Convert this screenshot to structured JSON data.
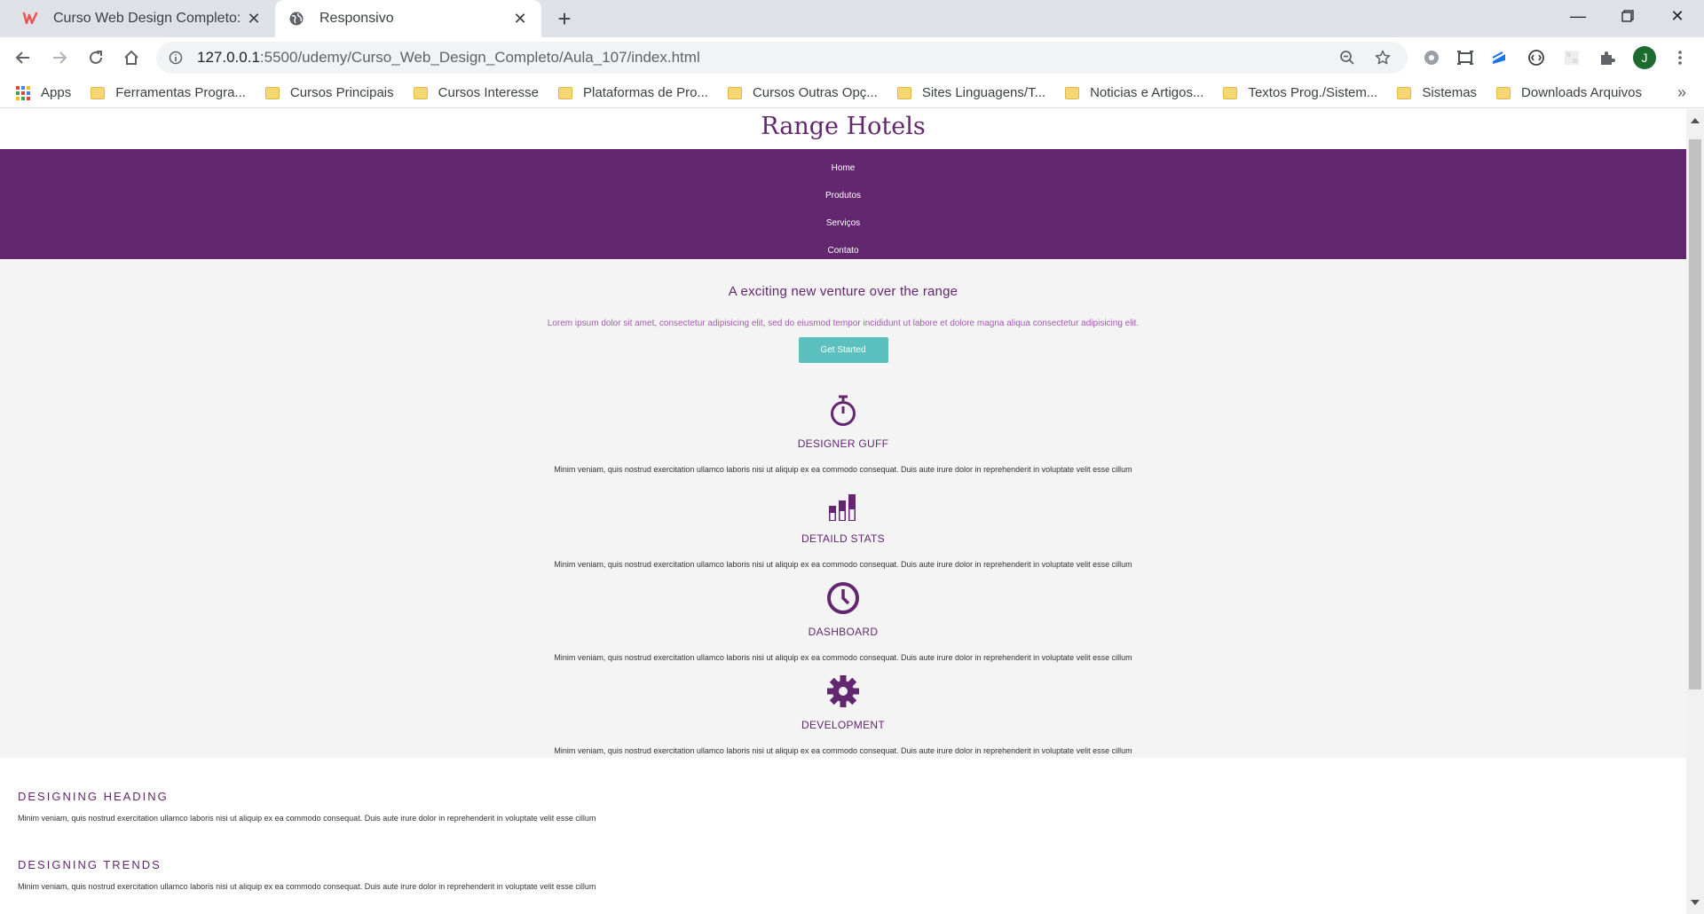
{
  "browser": {
    "tabs": [
      {
        "title": "Curso Web Design Completo: HT",
        "active": false
      },
      {
        "title": "Responsivo",
        "active": true
      }
    ],
    "url": {
      "host": "127.0.0.1",
      "path": ":5500/udemy/Curso_Web_Design_Completo/Aula_107/index.html"
    },
    "profile_initial": "J",
    "bookmarks": [
      "Apps",
      "Ferramentas Progra...",
      "Cursos Principais",
      "Cursos Interesse",
      "Plataformas de Pro...",
      "Cursos Outras Opç...",
      "Sites Linguagens/T...",
      "Noticias e Artigos...",
      "Textos Prog./Sistem...",
      "Sistemas",
      "Downloads Arquivos"
    ]
  },
  "page": {
    "brand": "Range Hotels",
    "nav": [
      "Home",
      "Produtos",
      "Serviços",
      "Contato"
    ],
    "hero": {
      "title": "A exciting new venture over the range",
      "lead": "Lorem ipsum dolor sit amet, consectetur adipisicing elit, sed do eiusmod tempor incididunt ut labore et dolore magna aliqua consectetur adipisicing elit.",
      "button": "Get Started"
    },
    "features": [
      {
        "icon": "stopwatch-icon",
        "title": "DESIGNER GUFF",
        "text": "Minim veniam, quis nostrud exercitation ullamco laboris nisi ut aliquip ex ea commodo consequat. Duis aute irure dolor in reprehenderit in voluptate velit esse cillum"
      },
      {
        "icon": "bar-chart-icon",
        "title": "DETAILD STATS",
        "text": "Minim veniam, quis nostrud exercitation ullamco laboris nisi ut aliquip ex ea commodo consequat. Duis aute irure dolor in reprehenderit in voluptate velit esse cillum"
      },
      {
        "icon": "clock-icon",
        "title": "DASHBOARD",
        "text": "Minim veniam, quis nostrud exercitation ullamco laboris nisi ut aliquip ex ea commodo consequat. Duis aute irure dolor in reprehenderit in voluptate velit esse cillum"
      },
      {
        "icon": "gear-icon",
        "title": "DEVELOPMENT",
        "text": "Minim veniam, quis nostrud exercitation ullamco laboris nisi ut aliquip ex ea commodo consequat. Duis aute irure dolor in reprehenderit in voluptate velit esse cillum"
      }
    ],
    "trends": [
      {
        "title": "DESIGNING HEADING",
        "text": "Minim veniam, quis nostrud exercitation ullamco laboris nisi ut aliquip ex ea commodo consequat. Duis aute irure dolor in reprehenderit in voluptate velit esse cillum"
      },
      {
        "title": "DESIGNING TRENDS",
        "text": "Minim veniam, quis nostrud exercitation ullamco laboris nisi ut aliquip ex ea commodo consequat. Duis aute irure dolor in reprehenderit in voluptate velit esse cillum"
      }
    ]
  },
  "colors": {
    "brand_purple": "#62276f",
    "button_teal": "#5bc0be",
    "lead_text": "#a35ab0",
    "hero_bg": "#f4f4f4"
  }
}
